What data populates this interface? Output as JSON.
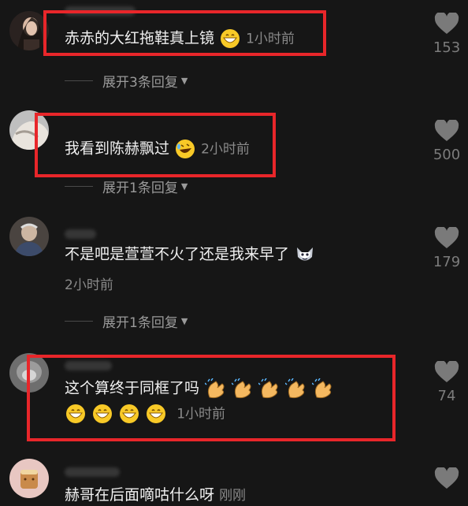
{
  "comments": [
    {
      "text": "赤赤的大红拖鞋真上镜",
      "time": "1小时前",
      "likes": "153",
      "expand": "展开3条回复"
    },
    {
      "text": "我看到陈赫飘过",
      "time": "2小时前",
      "likes": "500",
      "expand": "展开1条回复"
    },
    {
      "text": "不是吧是萱萱不火了还是我来早了",
      "time": "2小时前",
      "likes": "179",
      "expand": "展开1条回复"
    },
    {
      "text": "这个算终于同框了吗",
      "time": "1小时前",
      "likes": "74"
    },
    {
      "text": "赫哥在后面嘀咕什么呀",
      "time": "刚刚"
    }
  ],
  "colors": {
    "highlight": "#e8262a",
    "background": "#161616"
  },
  "icons": {
    "like": "heart-icon",
    "expand": "caret-down-icon"
  }
}
